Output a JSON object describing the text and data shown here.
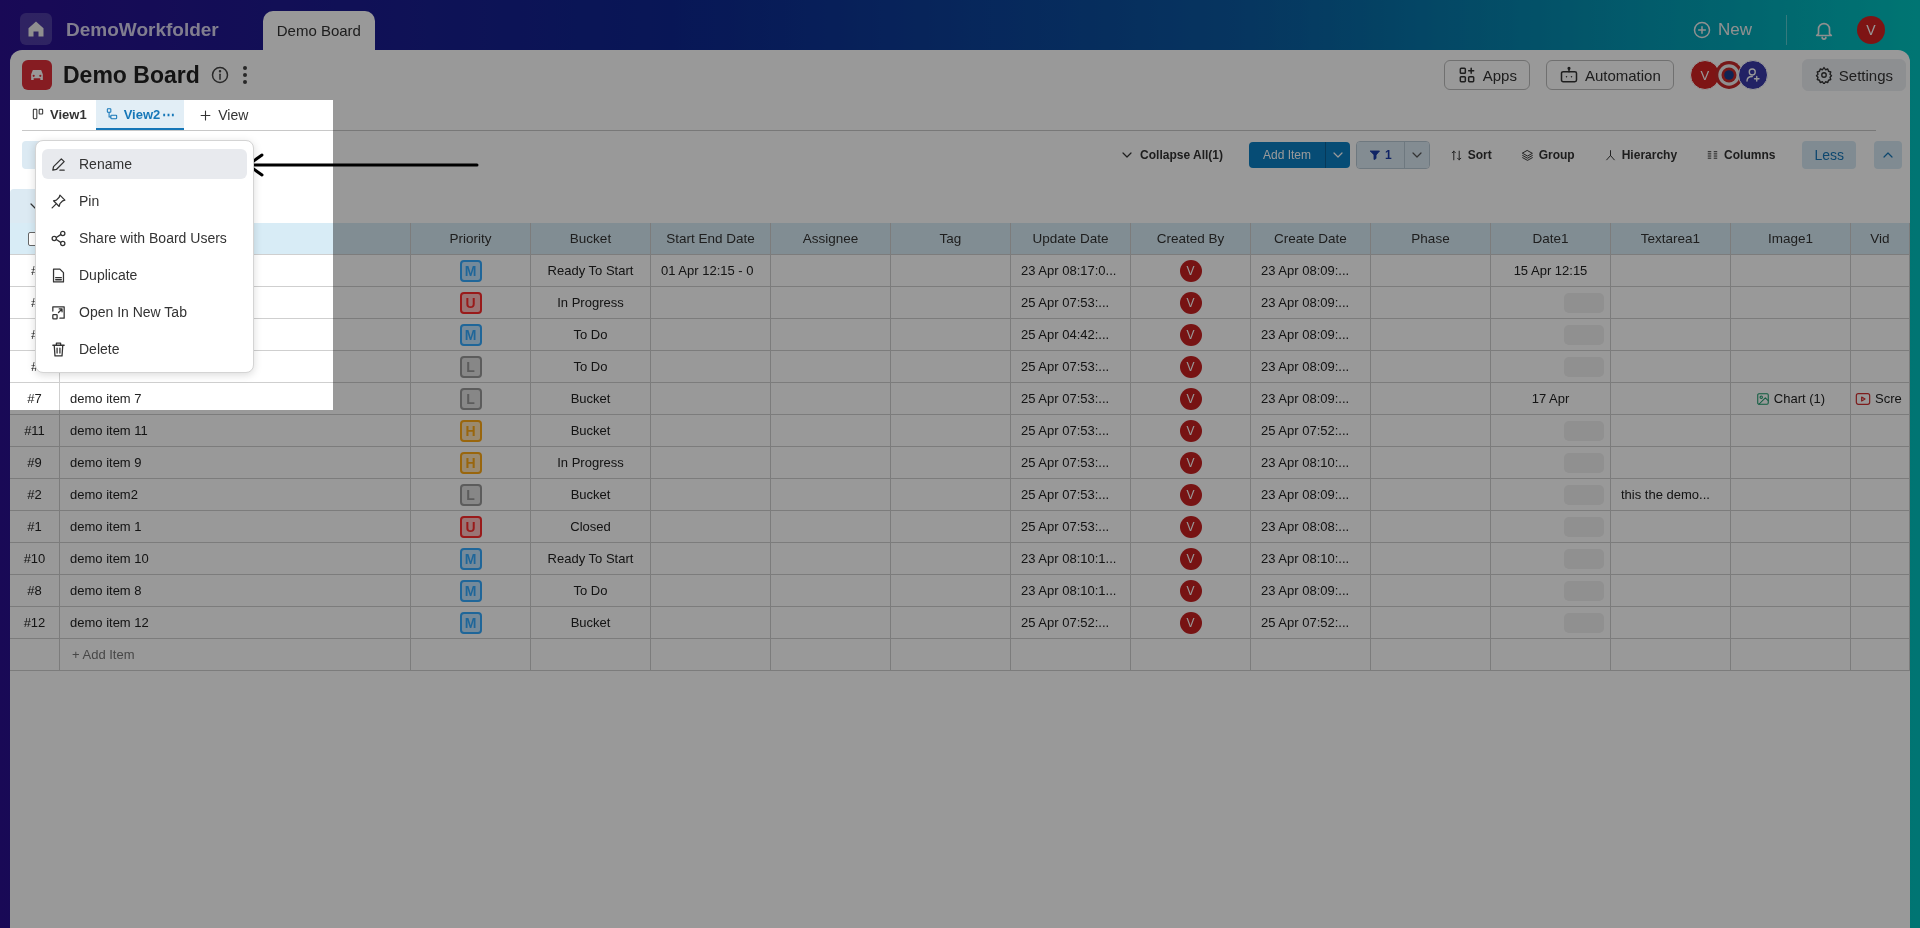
{
  "topbar": {
    "workspace": "DemoWorkfolder",
    "tabs": [
      {
        "label": "Demo Board",
        "selected": true
      }
    ],
    "new_label": "New",
    "user_initial": "V"
  },
  "board": {
    "title": "Demo Board",
    "buttons": [
      {
        "kind": "apps",
        "label": "Apps"
      },
      {
        "kind": "automation",
        "label": "Automation"
      }
    ],
    "member_initial": "V",
    "settings_label": "Settings"
  },
  "views": [
    {
      "label": "View1",
      "kind": "board",
      "selected": false
    },
    {
      "label": "View2",
      "kind": "list",
      "selected": true
    }
  ],
  "view_more": "⋯",
  "add_view": "View",
  "toolbar": {
    "collapse": "Collapse All(1)",
    "add_item": "Add Item",
    "filter_count": "1",
    "tools": [
      {
        "kind": "sort",
        "label": "Sort"
      },
      {
        "kind": "group",
        "label": "Group"
      },
      {
        "kind": "hierarchy",
        "label": "Hierarchy"
      },
      {
        "kind": "columns",
        "label": "Columns"
      }
    ],
    "less": "Less"
  },
  "table": {
    "group": {
      "expanded": true
    },
    "select_all": {
      "checked": false
    },
    "columns": [
      {
        "label": "Priority",
        "kind": "priority"
      },
      {
        "label": "Bucket",
        "kind": "text"
      },
      {
        "label": "Start End Date",
        "kind": "text"
      },
      {
        "label": "Assignee",
        "kind": "text"
      },
      {
        "label": "Tag",
        "kind": "text"
      },
      {
        "label": "Update Date",
        "kind": "text"
      },
      {
        "label": "Created By",
        "kind": "avatar"
      },
      {
        "label": "Create Date",
        "kind": "text"
      },
      {
        "label": "Phase",
        "kind": "text"
      },
      {
        "label": "Date1",
        "kind": "date"
      },
      {
        "label": "Textarea1",
        "kind": "text"
      },
      {
        "label": "Image1",
        "kind": "image"
      },
      {
        "label": "Vid",
        "kind": "video"
      }
    ],
    "rows": [
      {
        "id": "#",
        "cells": [
          {
            "label": "M",
            "color": "#1f6699"
          },
          "Ready To Start",
          "01 Apr 12:15  -  0",
          null,
          null,
          "23 Apr 08:17:0...",
          "V",
          "23 Apr 08:09:...",
          null,
          "15 Apr 12:15",
          null,
          null,
          null
        ]
      },
      {
        "id": "#",
        "cells": [
          {
            "label": "U",
            "color": "#991a1a"
          },
          "In Progress",
          null,
          null,
          null,
          "25 Apr 07:53:...",
          "V",
          "23 Apr 08:09:...",
          null,
          null,
          null,
          null,
          null
        ]
      },
      {
        "id": "#",
        "cells": [
          {
            "label": "M",
            "color": "#1f6699"
          },
          "To Do",
          null,
          null,
          null,
          "25 Apr 04:42:...",
          "V",
          "23 Apr 08:09:...",
          null,
          null,
          null,
          null,
          null
        ]
      },
      {
        "id": "#",
        "cells": [
          {
            "label": "L",
            "color": "#5c5c5c"
          },
          "To Do",
          null,
          null,
          null,
          "25 Apr 07:53:...",
          "V",
          "23 Apr 08:09:...",
          null,
          null,
          null,
          null,
          null
        ]
      },
      {
        "id": "#7",
        "name": "demo item 7",
        "cells": [
          {
            "label": "L",
            "color": "#5c5c5c"
          },
          "Bucket",
          null,
          null,
          null,
          "25 Apr 07:53:...",
          "V",
          "23 Apr 08:09:...",
          null,
          "17 Apr",
          null,
          "Chart (1)",
          "Scre"
        ]
      },
      {
        "id": "#11",
        "name": "demo item 11",
        "cells": [
          {
            "label": "H",
            "color": "#99660d"
          },
          "Bucket",
          null,
          null,
          null,
          "25 Apr 07:53:...",
          "V",
          "25 Apr 07:52:...",
          null,
          null,
          null,
          null,
          null
        ]
      },
      {
        "id": "#9",
        "name": "demo item 9",
        "cells": [
          {
            "label": "H",
            "color": "#99660d"
          },
          "In Progress",
          null,
          null,
          null,
          "25 Apr 07:53:...",
          "V",
          "23 Apr 08:10:...",
          null,
          null,
          null,
          null,
          null
        ]
      },
      {
        "id": "#2",
        "name": "demo item2",
        "cells": [
          {
            "label": "L",
            "color": "#5c5c5c"
          },
          "Bucket",
          null,
          null,
          null,
          "25 Apr 07:53:...",
          "V",
          "23 Apr 08:09:...",
          null,
          null,
          "this the demo...",
          null,
          null
        ]
      },
      {
        "id": "#1",
        "name": "demo item 1",
        "cells": [
          {
            "label": "U",
            "color": "#991a1a"
          },
          "Closed",
          null,
          null,
          null,
          "25 Apr 07:53:...",
          "V",
          "23 Apr 08:08:...",
          null,
          null,
          null,
          null,
          null
        ]
      },
      {
        "id": "#10",
        "name": "demo item 10",
        "cells": [
          {
            "label": "M",
            "color": "#1f6699"
          },
          "Ready To Start",
          null,
          null,
          null,
          "23 Apr 08:10:1...",
          "V",
          "23 Apr 08:10:...",
          null,
          null,
          null,
          null,
          null
        ]
      },
      {
        "id": "#8",
        "name": "demo item 8",
        "cells": [
          {
            "label": "M",
            "color": "#1f6699"
          },
          "To Do",
          null,
          null,
          null,
          "23 Apr 08:10:1...",
          "V",
          "23 Apr 08:09:...",
          null,
          null,
          null,
          null,
          null
        ]
      },
      {
        "id": "#12",
        "name": "demo item 12",
        "cells": [
          {
            "label": "M",
            "color": "#1f6699"
          },
          "Bucket",
          null,
          null,
          null,
          "25 Apr 07:52:...",
          "V",
          "25 Apr 07:52:...",
          null,
          null,
          null,
          null,
          null
        ]
      }
    ],
    "add_item": "+ Add Item"
  },
  "menu": {
    "items": [
      {
        "kind": "rename",
        "label": "Rename",
        "highlighted": true
      },
      {
        "kind": "pin",
        "label": "Pin",
        "highlighted": false
      },
      {
        "kind": "share",
        "label": "Share with Board Users",
        "highlighted": false
      },
      {
        "kind": "duplicate",
        "label": "Duplicate",
        "highlighted": false
      },
      {
        "kind": "open",
        "label": "Open In New Tab",
        "highlighted": false
      },
      {
        "kind": "delete",
        "label": "Delete",
        "highlighted": false
      }
    ]
  }
}
